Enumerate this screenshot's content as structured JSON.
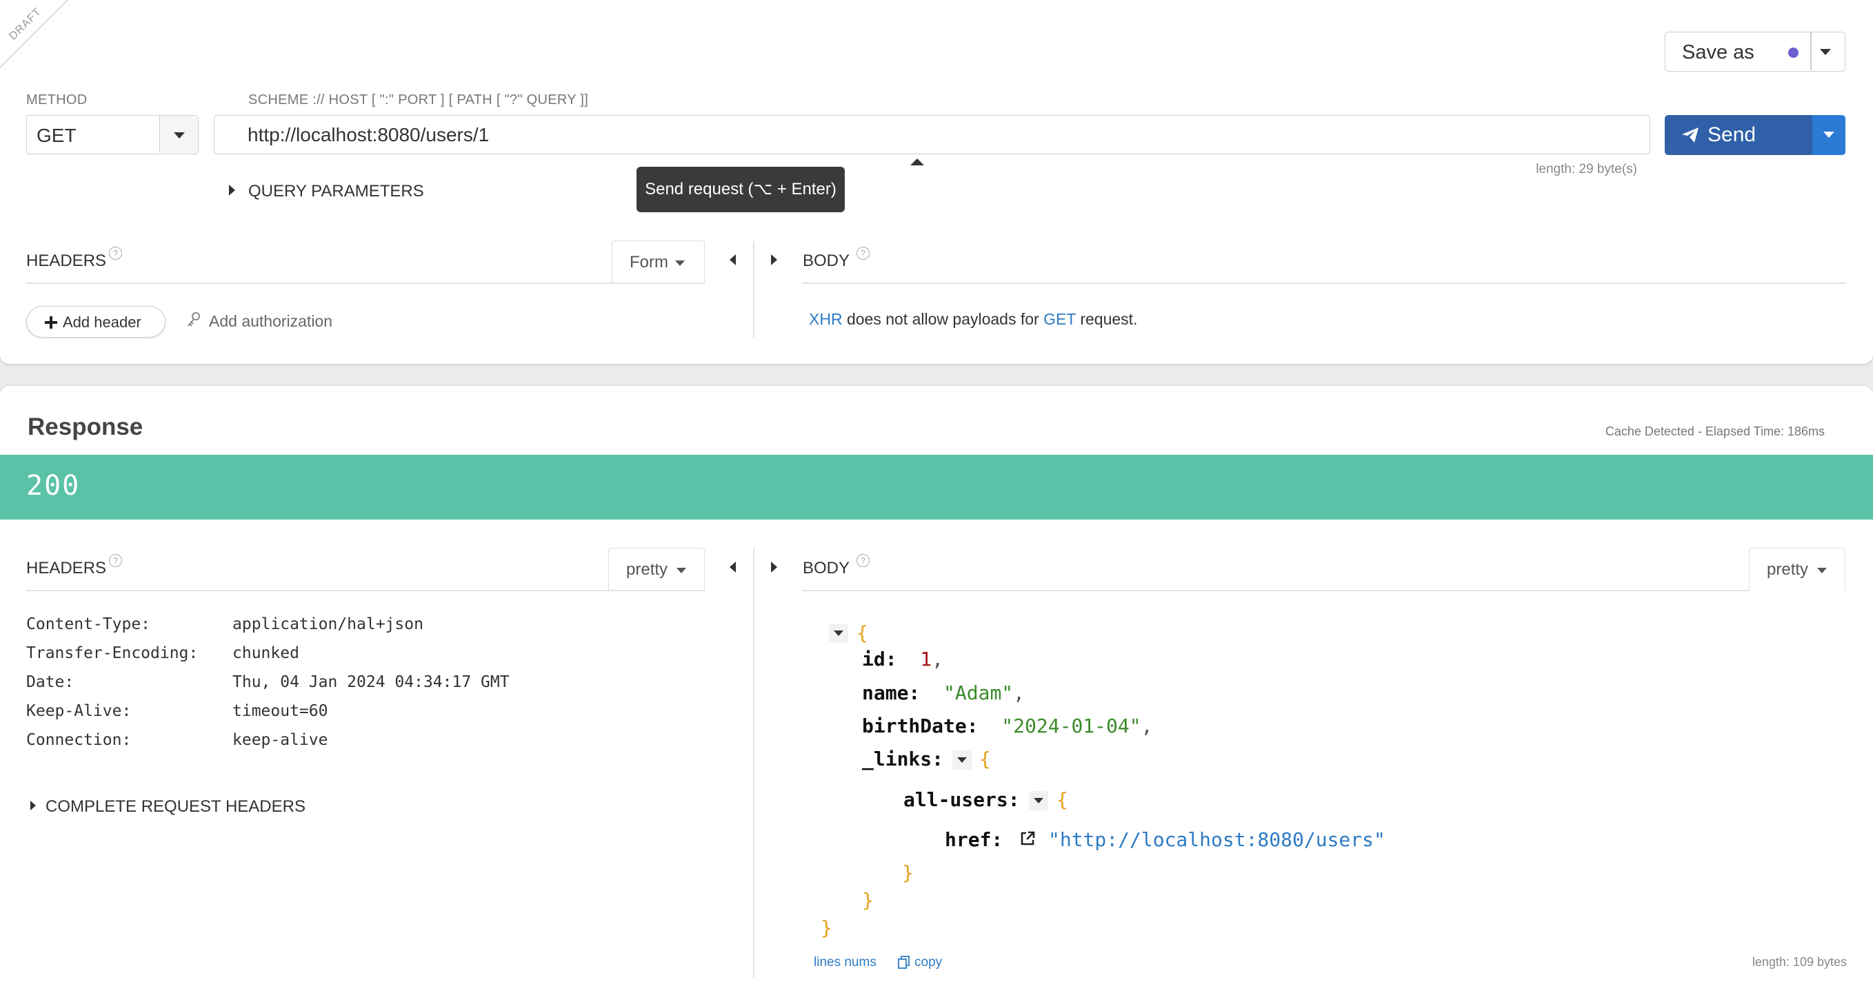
{
  "request": {
    "draft_label": "DRAFT",
    "method_label": "METHOD",
    "method_value": "GET",
    "url_label": "SCHEME :// HOST [ \":\" PORT ] [ PATH [ \"?\" QUERY ]]",
    "url_value": "http://localhost:8080/users/1",
    "url_length": "length: 29 byte(s)",
    "tooltip": "Send request (⌥ + Enter)",
    "query_params_label": "QUERY PARAMETERS",
    "save_as_label": "Save as",
    "send_label": "Send",
    "headers_title": "HEADERS",
    "headers_mode": "Form",
    "add_header_label": "Add header",
    "add_authorization_label": "Add authorization",
    "body_title": "BODY",
    "body_msg": {
      "xhr": "XHR",
      "middle": " does not allow payloads for ",
      "method": "GET",
      "end": " request."
    },
    "accent_color": "#2f60a8"
  },
  "response": {
    "title": "Response",
    "cache_info": "Cache Detected - Elapsed Time: 186ms",
    "status_code": "200",
    "status_color": "#5bc2a7",
    "headers_title": "HEADERS",
    "headers_mode": "pretty",
    "headers": [
      {
        "key": "Content-Type:",
        "value": "application/hal+json"
      },
      {
        "key": "Transfer-Encoding:",
        "value": "chunked"
      },
      {
        "key": "Date:",
        "value": "Thu, 04 Jan 2024 04:34:17 GMT"
      },
      {
        "key": "Keep-Alive:",
        "value": "timeout=60"
      },
      {
        "key": "Connection:",
        "value": "keep-alive"
      }
    ],
    "complete_request_headers_label": "COMPLETE REQUEST HEADERS",
    "body_title": "BODY",
    "body_mode": "pretty",
    "json": {
      "id_key": "id:",
      "id_val": "1",
      "name_key": "name:",
      "name_val": "\"Adam\"",
      "birth_key": "birthDate:",
      "birth_val": "\"2024-01-04\"",
      "links_key": "_links:",
      "all_users_key": "all-users:",
      "href_key": "href:",
      "href_val": "\"http://localhost:8080/users\""
    },
    "lines_nums_label": "lines nums",
    "copy_label": "copy",
    "body_length": "length: 109 bytes"
  }
}
